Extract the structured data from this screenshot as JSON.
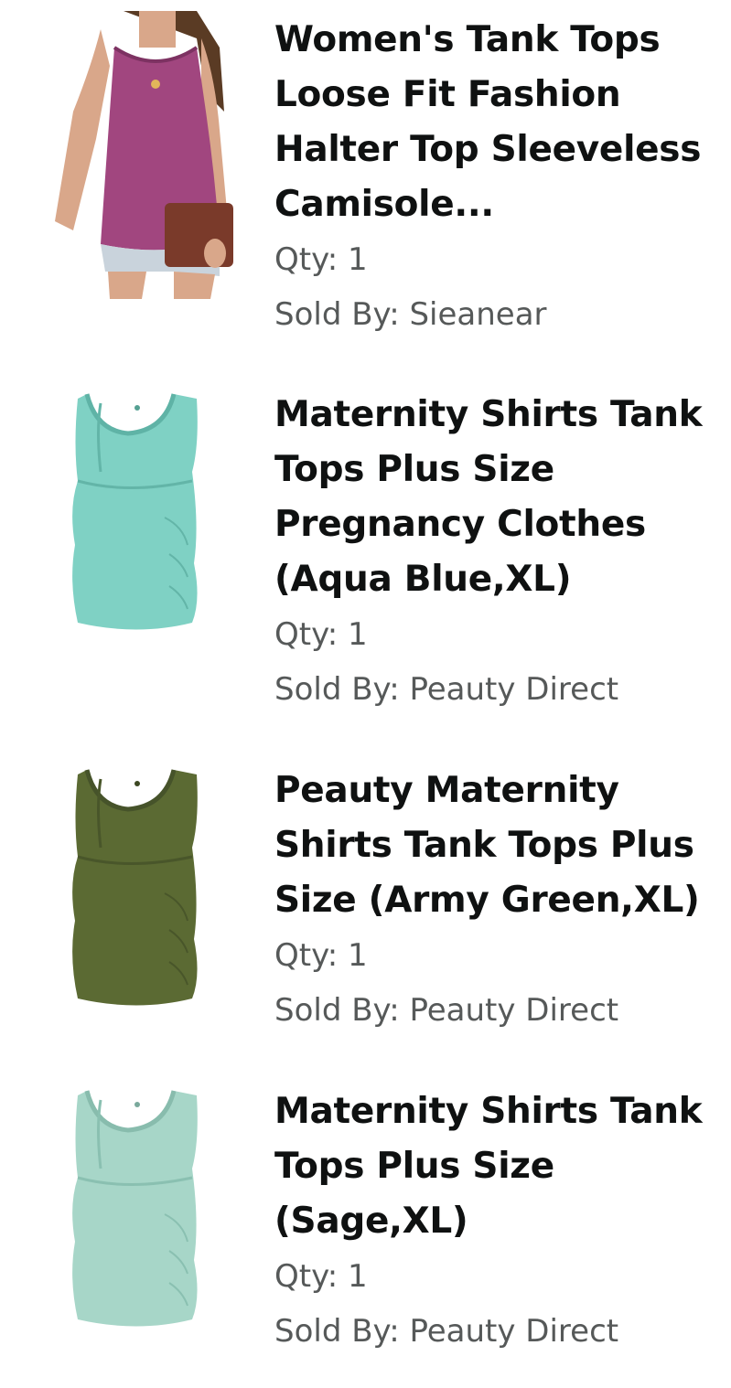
{
  "items": [
    {
      "title": "Women's Tank Tops\nLoose Fit Fashion\nHalter Top Sleeveless\nCamisole...",
      "qty": "Qty: 1",
      "seller": "Sold By: Sieanear",
      "image_icon": "purple-halter-top-photo"
    },
    {
      "title": "Maternity Shirts Tank\nTops Plus Size\nPregnancy Clothes\n(Aqua Blue,XL)",
      "qty": "Qty: 1",
      "seller": "Sold By: Peauty Direct",
      "image_icon": "aqua-maternity-tank-photo",
      "color": "#7fd1c4"
    },
    {
      "title": "Peauty Maternity\nShirts Tank Tops Plus\nSize (Army Green,XL)",
      "qty": "Qty: 1",
      "seller": "Sold By: Peauty Direct",
      "image_icon": "army-green-maternity-tank-photo",
      "color": "#5b6a33"
    },
    {
      "title": "Maternity Shirts Tank\nTops Plus Size\n(Sage,XL)",
      "qty": "Qty: 1",
      "seller": "Sold By: Peauty Direct",
      "image_icon": "sage-maternity-tank-photo",
      "color": "#a7d6c8"
    }
  ]
}
